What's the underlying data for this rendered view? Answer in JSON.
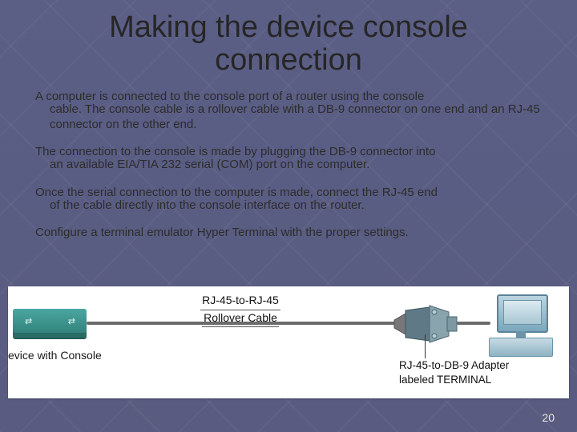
{
  "title": "Making the device console connection",
  "paragraphs": {
    "p1_first": "A computer is connected to the console port of a router using the console",
    "p1_rest": "cable. The console cable is a rollover cable with a DB-9 connector on one end and an RJ-45 connector on the other end.",
    "p2_first": "The connection to the console is made by plugging the DB-9 connector into",
    "p2_rest": "an available EIA/TIA 232 serial (COM) port on the computer.",
    "p3_first": "Once the serial connection to the computer is made, connect the RJ-45 end",
    "p3_rest": "of the cable directly into the console interface on the router.",
    "p4": "Configure a terminal emulator Hyper Terminal with the proper settings."
  },
  "diagram": {
    "device_label": "evice with Console",
    "cable_label_top": "RJ-45-to-RJ-45",
    "cable_label_bottom": "Rollover Cable",
    "adapter_label_top": "RJ-45-to-DB-9 Adapter",
    "adapter_label_bottom": "labeled TERMINAL"
  },
  "page_number": "20"
}
